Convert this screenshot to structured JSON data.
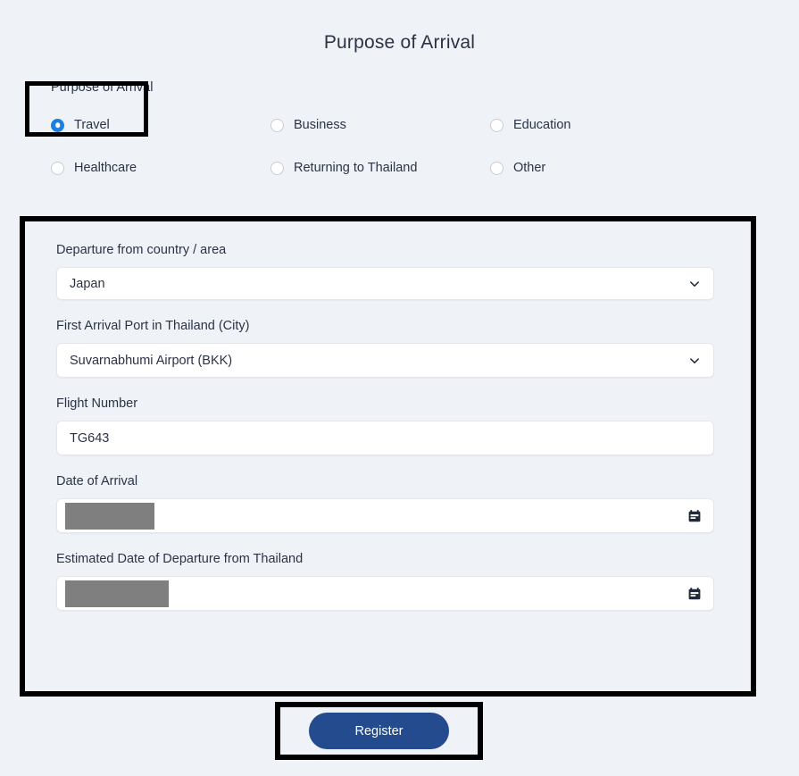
{
  "page": {
    "title": "Purpose of Arrival"
  },
  "purpose": {
    "label": "Purpose of Arrival",
    "options": [
      {
        "label": "Travel",
        "selected": true
      },
      {
        "label": "Business",
        "selected": false
      },
      {
        "label": "Education",
        "selected": false
      },
      {
        "label": "Healthcare",
        "selected": false
      },
      {
        "label": "Returning to Thailand",
        "selected": false
      },
      {
        "label": "Other",
        "selected": false
      }
    ]
  },
  "details": {
    "departure_country": {
      "label": "Departure from country / area",
      "value": "Japan",
      "control": "select",
      "icon": "chevron-down-icon"
    },
    "arrival_port": {
      "label": "First Arrival Port in Thailand (City)",
      "value": "Suvarnabhumi Airport (BKK)",
      "control": "select",
      "icon": "chevron-down-icon"
    },
    "flight_number": {
      "label": "Flight Number",
      "value": "TG643",
      "control": "text"
    },
    "date_of_arrival": {
      "label": "Date of Arrival",
      "value": "",
      "redacted": true,
      "control": "date",
      "icon": "calendar-icon"
    },
    "date_of_departure": {
      "label": "Estimated Date of Departure from Thailand",
      "value": "",
      "redacted": true,
      "control": "date",
      "icon": "calendar-icon"
    }
  },
  "actions": {
    "register_label": "Register"
  },
  "colors": {
    "page_background": "#eff3f7",
    "text": "#2b3245",
    "radio_selected": "#1b7fe3",
    "register_button": "#234b8d",
    "highlight_outline": "#000000",
    "redaction": "#7f7f7f",
    "input_background": "#ffffff",
    "input_border": "#e3e7ec"
  }
}
